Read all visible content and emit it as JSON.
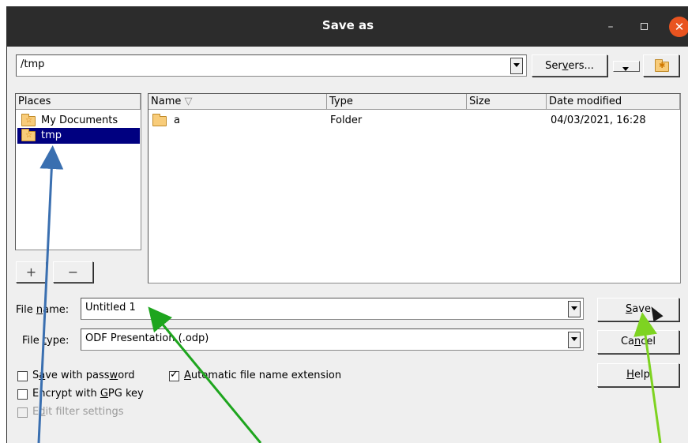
{
  "window": {
    "title": "Save as",
    "minimize_icon": "–",
    "close_icon": "✕"
  },
  "path_bar": {
    "value": "/tmp",
    "servers_button": {
      "pre": "Ser",
      "accel": "v",
      "post": "ers..."
    }
  },
  "places": {
    "header": "Places",
    "items": [
      {
        "label": "My Documents",
        "selected": false
      },
      {
        "label": "tmp",
        "selected": true
      }
    ],
    "add_label": "+",
    "remove_label": "−"
  },
  "file_list": {
    "columns": [
      "Name",
      "Type",
      "Size",
      "Date modified"
    ],
    "sort_indicator": "▽",
    "rows": [
      {
        "name": "a",
        "type": "Folder",
        "size": "",
        "date": "04/03/2021, 16:28"
      }
    ]
  },
  "file_name": {
    "label_pre": "File ",
    "label_accel": "n",
    "label_post": "ame:",
    "value": "Untitled 1"
  },
  "file_type": {
    "label_pre": "File ",
    "label_accel": "t",
    "label_post": "ype:",
    "value": "ODF Presentation (.odp)"
  },
  "options": {
    "save_with_password": {
      "pre": "S",
      "accel": "a",
      "mid": "ve with pass",
      "accel2": "w",
      "post": "ord",
      "checked": false
    },
    "encrypt_gpg": {
      "pre": "Encrypt with ",
      "accel": "G",
      "post": "PG key",
      "checked": false
    },
    "edit_filter": {
      "pre": "E",
      "accel": "d",
      "post": "it filter settings",
      "checked": false,
      "disabled": true
    },
    "auto_extension": {
      "pre": "",
      "accel": "A",
      "post": "utomatic file name extension",
      "checked": true
    }
  },
  "buttons": {
    "save": {
      "pre": "",
      "accel": "S",
      "post": "ave"
    },
    "cancel": {
      "pre": "Ca",
      "accel": "n",
      "post": "cel"
    },
    "help": {
      "pre": "",
      "accel": "H",
      "post": "elp"
    }
  },
  "annotation_colors": {
    "blue_arrow": "#3a6fb0",
    "green_arrow": "#1ea51e",
    "lime_arrow": "#7ed321"
  }
}
